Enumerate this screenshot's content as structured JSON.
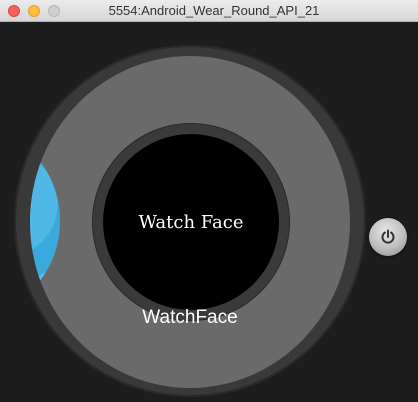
{
  "window": {
    "title": "5554:Android_Wear_Round_API_21"
  },
  "watch": {
    "preview_text": "Watch Face",
    "face_label": "WatchFace",
    "power_icon": "power-icon",
    "colors": {
      "background": "#1e1d1e",
      "bezel": "#3a393a",
      "screen": "#6b6a6b",
      "face": "#000000",
      "accent": "#4fb8e6"
    }
  }
}
